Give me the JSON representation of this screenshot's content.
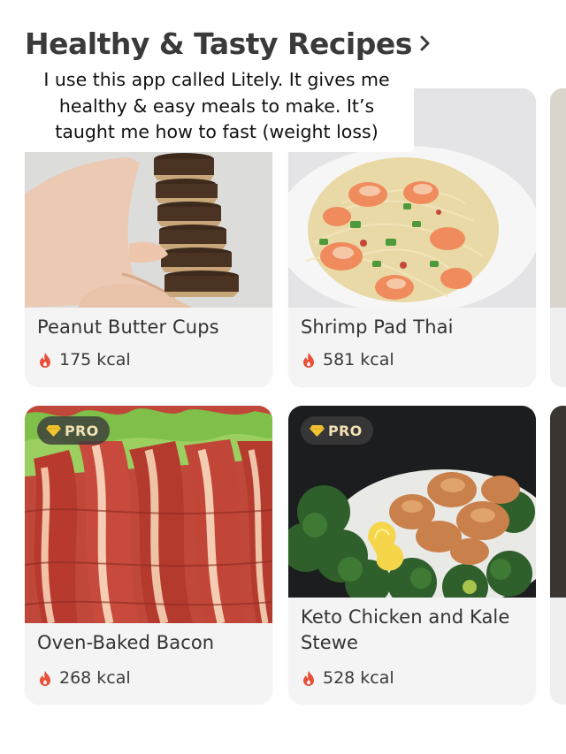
{
  "section": {
    "title": "Healthy & Tasty Recipes",
    "chevron_icon": "chevron-right-icon"
  },
  "caption": {
    "lines": [
      "I use this app called Litely. It gives me",
      "healthy & easy meals to make. It’s",
      "taught me how to fast (weight loss)"
    ]
  },
  "recipes": [
    {
      "name": "Peanut Butter Cups",
      "kcal": "175 kcal",
      "pro": false,
      "image_icon": "peanut-butter-cups-photo"
    },
    {
      "name": "Shrimp Pad Thai",
      "kcal": "581 kcal",
      "pro": false,
      "image_icon": "shrimp-pad-thai-photo"
    },
    {
      "name": "Oven-Baked Bacon",
      "kcal": "268 kcal",
      "pro": true,
      "image_icon": "bacon-photo"
    },
    {
      "name": "Keto Chicken and Kale Stewe",
      "kcal": "528 kcal",
      "pro": true,
      "image_icon": "chicken-kale-photo"
    }
  ],
  "badge": {
    "label": "PRO",
    "icon": "diamond-icon"
  },
  "icons": {
    "calories": "flame-icon"
  },
  "colors": {
    "flame": "#e8503a",
    "badge_background": "#4a4a4a",
    "badge_text": "#f0e2b4",
    "diamond": "#f2c230",
    "card_background": "#f4f4f5"
  }
}
